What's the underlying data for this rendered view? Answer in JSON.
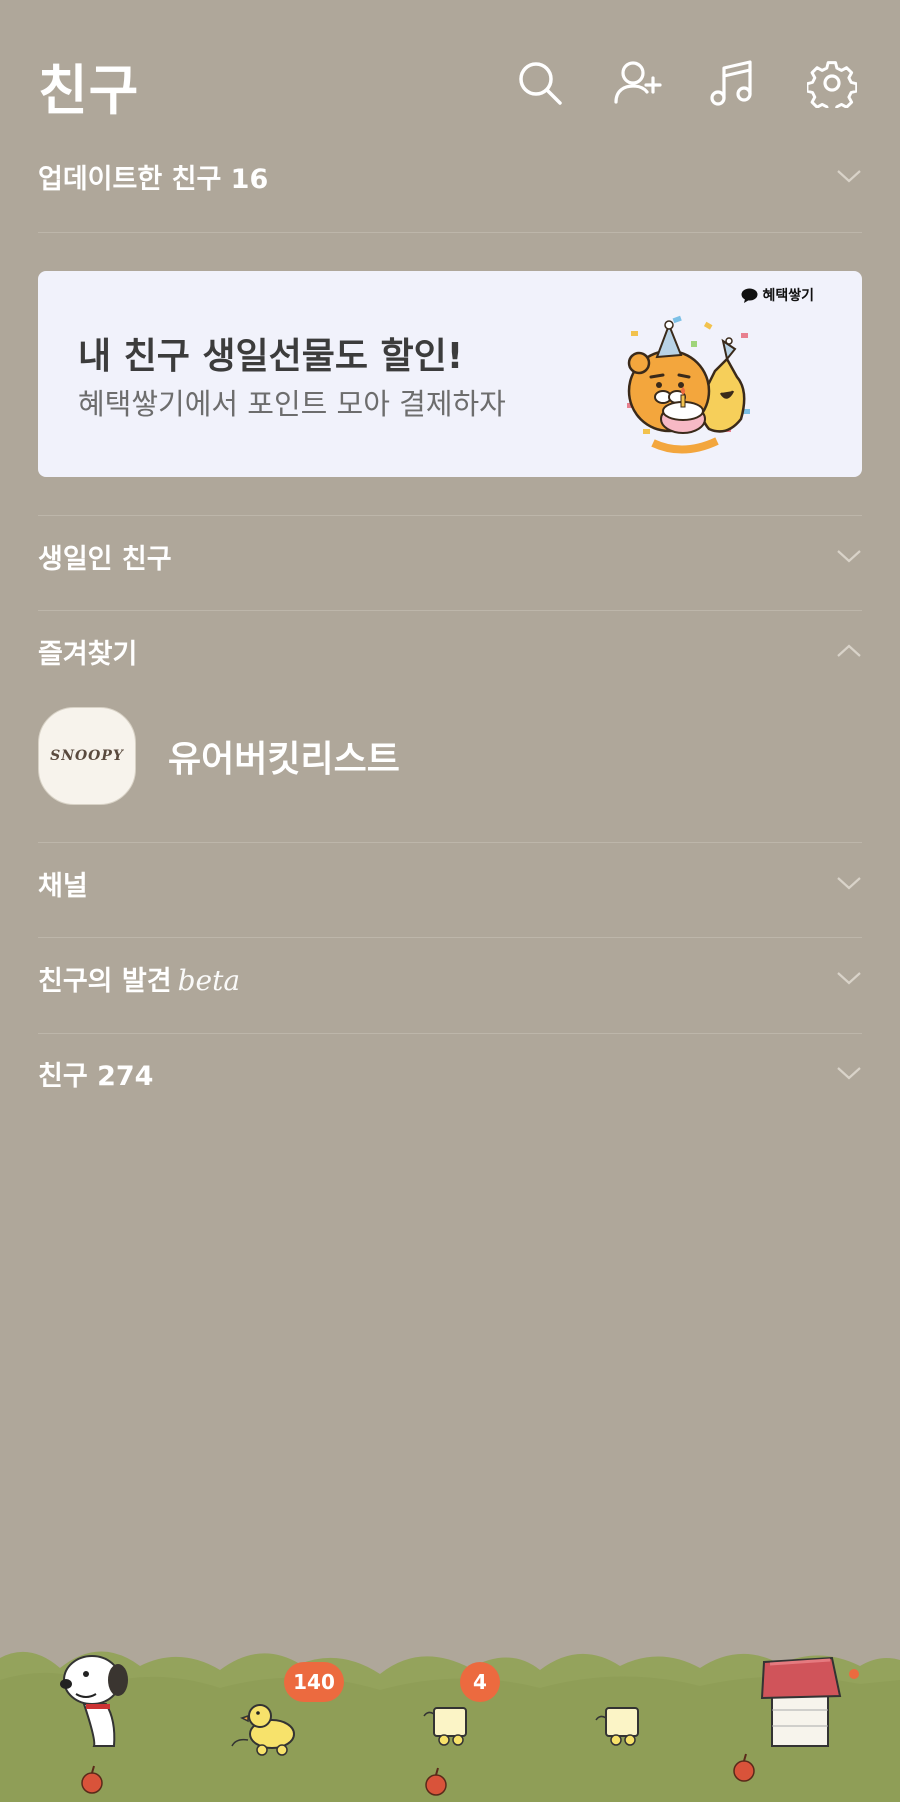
{
  "header": {
    "title": "친구",
    "icons": [
      "search-icon",
      "add-friend-icon",
      "music-icon",
      "settings-icon"
    ]
  },
  "sections": {
    "updated": {
      "label": "업데이트한 친구 16"
    },
    "birthday": {
      "label": "생일인 친구"
    },
    "favorites": {
      "label": "즐겨찾기"
    },
    "channel": {
      "label": "채널"
    },
    "discover": {
      "label": "친구의 발견",
      "beta": "beta"
    },
    "friends": {
      "label": "친구 274"
    }
  },
  "banner": {
    "title": "내 친구 생일선물도 할인!",
    "subtitle": "혜택쌓기에서 포인트 모아 결제하자",
    "tag": "혜택쌓기"
  },
  "favorites": {
    "items": [
      {
        "name": "유어버킷리스트",
        "avatar_text": "SNOOPY"
      }
    ]
  },
  "bottom_nav": {
    "items": [
      {
        "name": "friends-tab",
        "badge": ""
      },
      {
        "name": "chats-tab",
        "badge": "140"
      },
      {
        "name": "openchat-tab",
        "badge": "4"
      },
      {
        "name": "shopping-tab",
        "badge": ""
      },
      {
        "name": "more-tab",
        "badge": ""
      }
    ]
  },
  "colors": {
    "background": "#afa79a",
    "banner_bg": "#f1f2fb",
    "badge": "#ec6a3f",
    "grass": "#94a35c"
  }
}
